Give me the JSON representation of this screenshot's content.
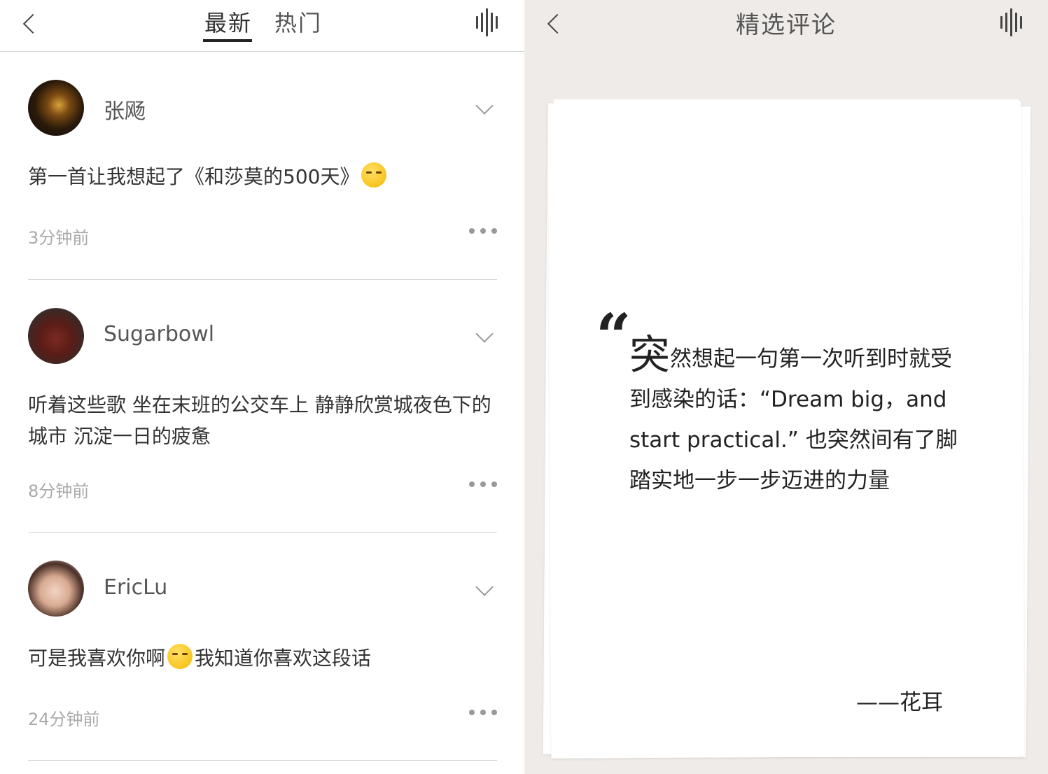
{
  "left": {
    "tabs": [
      {
        "label": "最新",
        "active": true
      },
      {
        "label": "热门",
        "active": false
      }
    ],
    "comments": [
      {
        "user": "张飏",
        "avatar": "night-street-photo",
        "text_before": "第一首让我想起了《和莎莫的500天》",
        "emoji": "kissing-closed-eyes",
        "text_after": "",
        "time": "3分钟前"
      },
      {
        "user": "Sugarbowl",
        "avatar": "supreme-hoodie-photo",
        "text_before": "听着这些歌 坐在末班的公交车上 静静欣赏城夜色下的城市 沉淀一日的疲惫",
        "emoji": "",
        "text_after": "",
        "time": "8分钟前"
      },
      {
        "user": "EricLu",
        "avatar": "girl-portrait-photo",
        "text_before": "可是我喜欢你啊",
        "emoji": "face-blowing-kiss",
        "text_after": "我知道你喜欢这段话",
        "time": "24分钟前"
      }
    ]
  },
  "right": {
    "title": "精选评论",
    "quote_mark": "“",
    "quote_first_char": "突",
    "quote_text": "然想起一句第一次听到时就受到感染的话：“Dream big，and start practical.” 也突然间有了脚踏实地一步一步迈进的力量",
    "author": "——花耳"
  },
  "colors": {
    "right_background": "#efebe8",
    "divider": "#d4d4d4",
    "timestamp": "#aaaaaa"
  }
}
